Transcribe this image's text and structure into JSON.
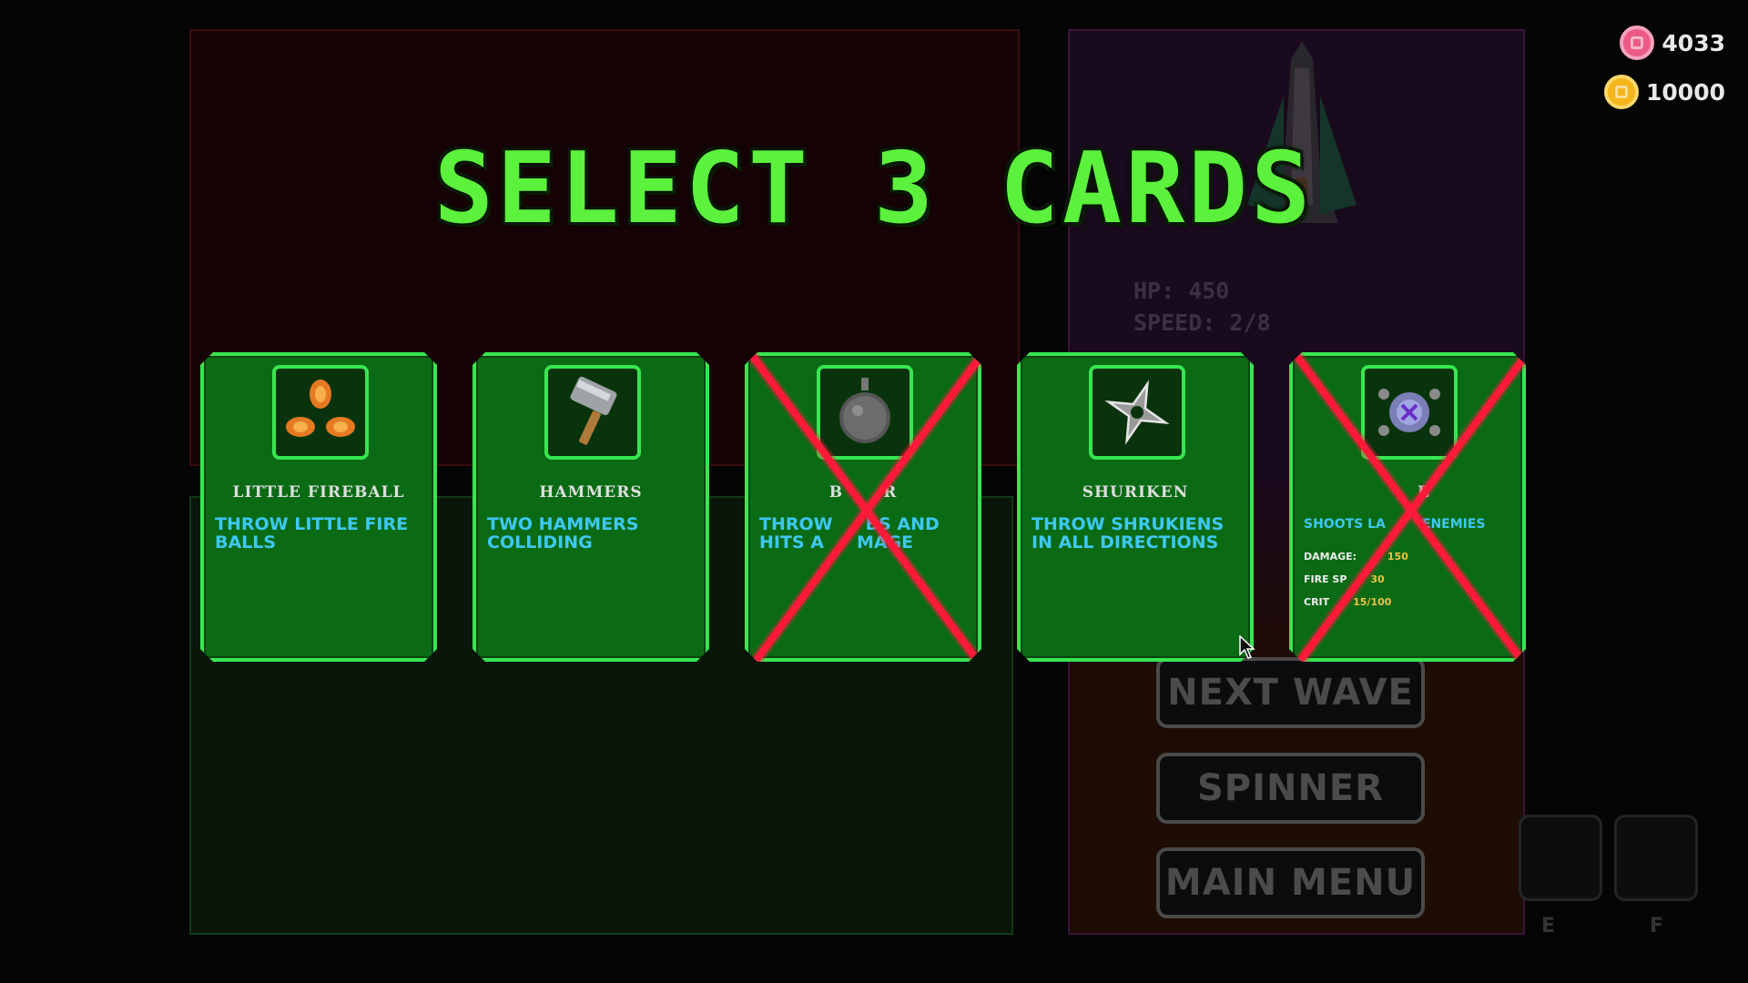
{
  "currency": {
    "gems": "4033",
    "coins": "10000",
    "gem_color": "#ec5b86",
    "coin_color": "#f5b51c"
  },
  "title": "SELECT 3 CARDS",
  "ship_stats": [
    "HP: 450",
    "SPEED: 2/8"
  ],
  "menu": {
    "next_wave": "NEXT WAVE",
    "spinner": "SPINNER",
    "main_menu": "MAIN MENU"
  },
  "slots": {
    "e": "E",
    "f": "F"
  },
  "cards": [
    {
      "name": "LITTLE FIREBALL",
      "description": "THROW LITTLE FIRE BALLS",
      "icon": "fireball-icon",
      "disabled": false
    },
    {
      "name": "HAMMERS",
      "description": "TWO HAMMERS COLLIDING",
      "icon": "hammer-icon",
      "disabled": false
    },
    {
      "name": "B",
      "name_right": "R",
      "description": "THROW",
      "description_b": "BS AND",
      "description_c": "HITS A",
      "description_d": "MAGE",
      "icon": "bomb-icon",
      "disabled": true
    },
    {
      "name": "SHURIKEN",
      "description": "THROW SHRUKIENS IN ALL DIRECTIONS",
      "icon": "shuriken-icon",
      "disabled": false
    },
    {
      "name": "E",
      "description_a": "SHOOTS LA",
      "description_b": "ENEMIES",
      "icon": "laser-orb-icon",
      "stats": {
        "damage_label": "DAMAGE:",
        "damage_value": "150",
        "fire_label": "FIRE SP",
        "fire_value": "30",
        "crit_label": "CRIT",
        "crit_value": "15/100"
      },
      "disabled": true
    }
  ],
  "colors": {
    "card_bg": "#0a6b14",
    "card_border": "#37e650",
    "title": "#5cf13c",
    "description": "#3ec8f2",
    "disabled_mark": "#ff1a3a"
  }
}
